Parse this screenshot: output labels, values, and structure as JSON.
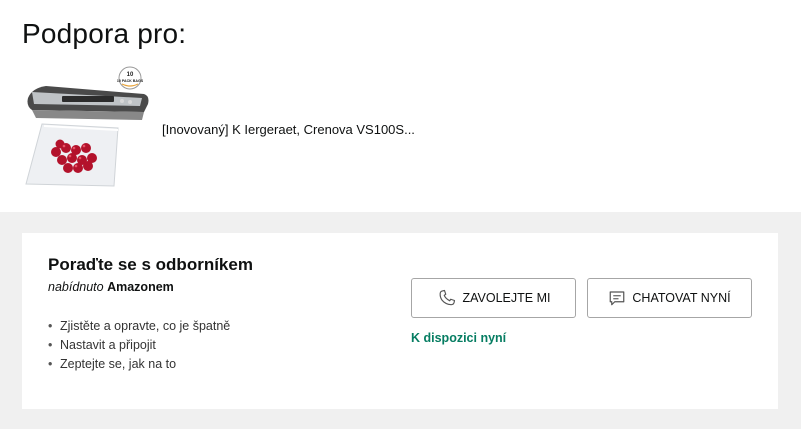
{
  "header": {
    "title": "Podpora pro:"
  },
  "product": {
    "image_label": "10 PACK BAGS",
    "title": "[Inovovaný] K Iergeraet, Crenova VS100S..."
  },
  "expert_card": {
    "heading": "Poraďte se s odborníkem",
    "offered_prefix": "nabídnuto",
    "offered_brand": "Amazonem",
    "bullets": [
      "Zjistěte a opravte, co je špatně",
      "Nastavit a připojit",
      "Zeptejte se, jak na to"
    ],
    "call_button": {
      "label": "ZAVOLEJTE MI",
      "icon": "phone-icon"
    },
    "chat_button": {
      "label": "CHATOVAT NYNÍ",
      "icon": "chat-icon"
    },
    "availability": "K dispozici nyní"
  },
  "colors": {
    "availability": "#067d62",
    "panel_bg": "#f0f0f0",
    "button_border": "#a6a6a6"
  }
}
